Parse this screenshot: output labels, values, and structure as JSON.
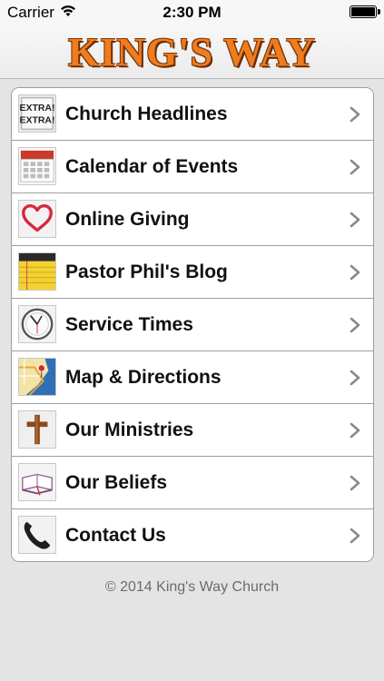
{
  "status": {
    "carrier": "Carrier",
    "time": "2:30 PM"
  },
  "header": {
    "title": "KING'S WAY"
  },
  "menu": [
    {
      "label": "Church Headlines",
      "icon": "newspaper-icon",
      "badge": "EXTRA!"
    },
    {
      "label": "Calendar of Events",
      "icon": "calendar-icon"
    },
    {
      "label": "Online Giving",
      "icon": "heart-icon"
    },
    {
      "label": "Pastor Phil's Blog",
      "icon": "notepad-icon"
    },
    {
      "label": "Service Times",
      "icon": "clock-icon"
    },
    {
      "label": "Map & Directions",
      "icon": "map-icon"
    },
    {
      "label": "Our Ministries",
      "icon": "cross-icon"
    },
    {
      "label": "Our Beliefs",
      "icon": "bible-icon"
    },
    {
      "label": "Contact Us",
      "icon": "phone-icon"
    }
  ],
  "footer": {
    "text": "© 2014 King's Way Church"
  },
  "colors": {
    "accent": "#f07c1c",
    "background": "#e4e4e4"
  }
}
